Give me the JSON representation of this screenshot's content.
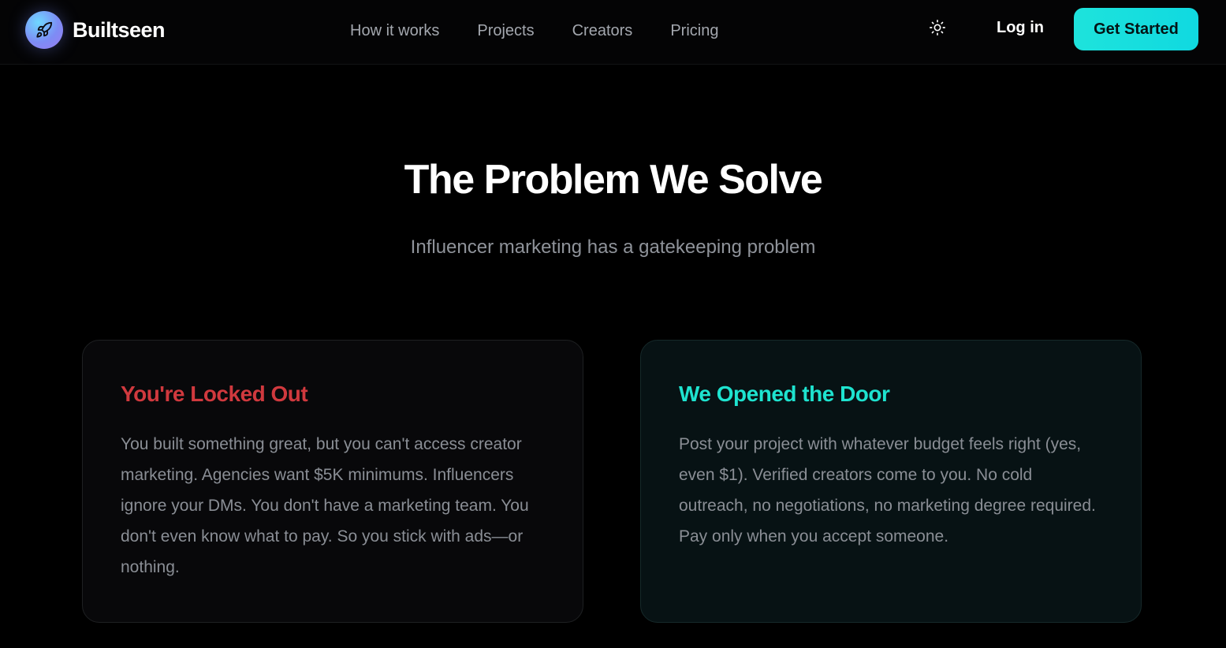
{
  "header": {
    "logo_text": "Builtseen",
    "logo_icon": "rocket-icon",
    "nav": [
      "How it works",
      "Projects",
      "Creators",
      "Pricing"
    ],
    "theme_icon": "sun-icon",
    "login_label": "Log in",
    "cta_label": "Get Started"
  },
  "hero": {
    "title": "The Problem We Solve",
    "subtitle": "Influencer marketing has a gatekeeping problem"
  },
  "cards": [
    {
      "title": "You're Locked Out",
      "body": "You built something great, but you can't access creator marketing. Agencies want $5K minimums. Influencers ignore your DMs. You don't have a marketing team. You don't even know what to pay. So you stick with ads—or nothing."
    },
    {
      "title": "We Opened the Door",
      "body": "Post your project with whatever budget feels right (yes, even $1). Verified creators come to you. No cold outreach, no negotiations, no marketing degree required. Pay only when you accept someone."
    }
  ],
  "colors": {
    "accent": "#1ee3dc",
    "problem": "#d0393e",
    "solution": "#1ee3cf",
    "background": "#000000"
  }
}
